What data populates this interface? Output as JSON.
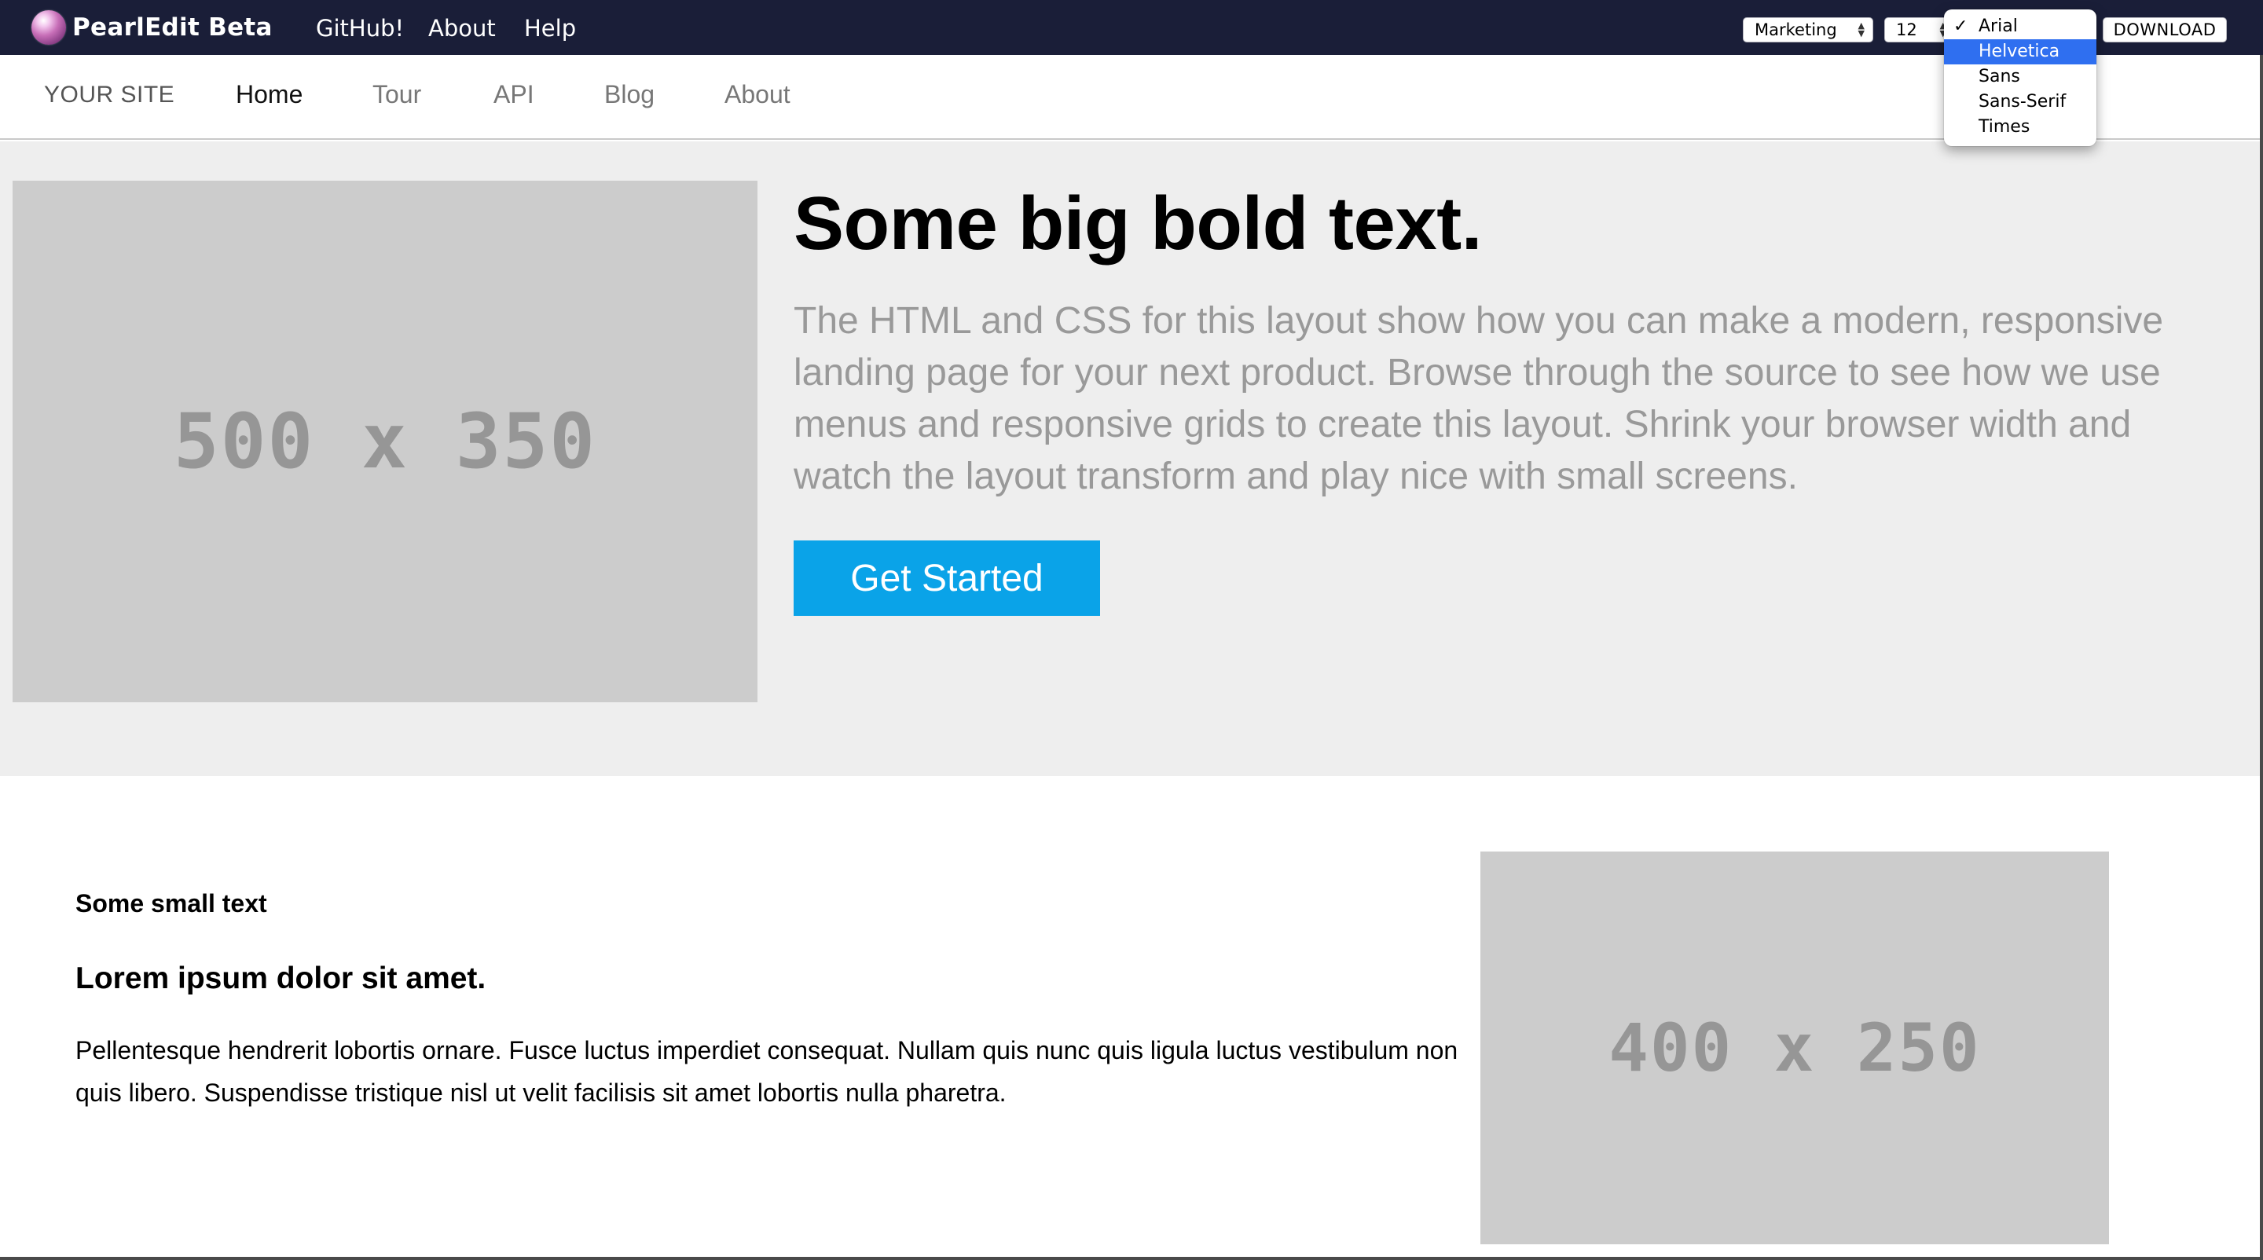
{
  "app": {
    "name": "PearlEdit Beta",
    "nav": [
      "GitHub!",
      "About",
      "Help"
    ],
    "template_select": "Marketing",
    "size_select": "12",
    "download_label": "DOWNLOAD",
    "font_menu": {
      "options": [
        "Arial",
        "Helvetica",
        "Sans",
        "Sans-Serif",
        "Times"
      ],
      "checked": "Arial",
      "highlighted": "Helvetica",
      "check_glyph": "✓"
    },
    "colors": {
      "appbar": "#1a1e38",
      "menu_highlight": "#2f6ff0"
    }
  },
  "site": {
    "brand": "YOUR SITE",
    "nav": [
      "Home",
      "Tour",
      "API",
      "Blog",
      "About"
    ]
  },
  "hero": {
    "image_placeholder": "500 x 350",
    "title": "Some big bold text.",
    "description": "The HTML and CSS for this layout show how you can make a modern, responsive landing page for your next product. Browse through the source to see how we use menus and responsive grids to create this layout. Shrink your browser width and watch the layout transform and play nice with small screens.",
    "cta_label": "Get Started",
    "cta_color": "#0aa3e8"
  },
  "content": {
    "small_text": "Some small text",
    "heading": "Lorem ipsum dolor sit amet.",
    "paragraph": "Pellentesque hendrerit lobortis ornare. Fusce luctus imperdiet consequat. Nullam quis nunc quis ligula luctus vestibulum non quis libero. Suspendisse tristique nisl ut velit facilisis sit amet lobortis nulla pharetra.",
    "image_placeholder": "400 x 250"
  }
}
